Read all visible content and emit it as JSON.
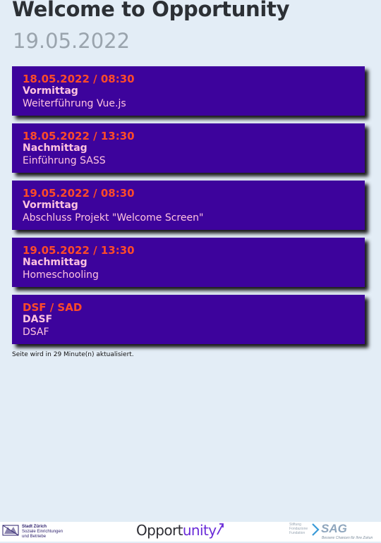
{
  "header": {
    "title": "Welcome to Opportunity",
    "date": "19.05.2022"
  },
  "schedule": [
    {
      "datetime": "18.05.2022 / 08:30",
      "period": "Vormittag",
      "topic": "Weiterführung Vue.js"
    },
    {
      "datetime": "18.05.2022 / 13:30",
      "period": "Nachmittag",
      "topic": "Einführung SASS"
    },
    {
      "datetime": "19.05.2022 / 08:30",
      "period": "Vormittag",
      "topic": "Abschluss Projekt \"Welcome Screen\""
    },
    {
      "datetime": "19.05.2022 / 13:30",
      "period": "Nachmittag",
      "topic": "Homeschooling"
    },
    {
      "datetime": "DSF / SAD",
      "period": "DASF",
      "topic": "DSAF"
    }
  ],
  "refresh_notice": "Seite wird in 29 Minute(n) aktualisiert.",
  "footer": {
    "city_logo": {
      "name": "Stadt Zürich",
      "line1": "Soziale Einrichtungen",
      "line2": "und Betriebe",
      "icon": "zurich-coat-of-arms-icon"
    },
    "opportunity_logo": {
      "part1": "Opport",
      "part2": "unity",
      "icon": "arrow-up-right-icon"
    },
    "sag_logo": {
      "small1": "Stiftung",
      "small2": "Fondazione",
      "small3": "Fundation",
      "name": "SAG",
      "tagline": "Bessere Chancen für Ihre Zukun",
      "icon": "chevron-right-icon"
    }
  },
  "colors": {
    "background": "#e3edf6",
    "card": "#3d039c",
    "datetime": "#ff4b28",
    "card_text": "#ffc2df"
  }
}
